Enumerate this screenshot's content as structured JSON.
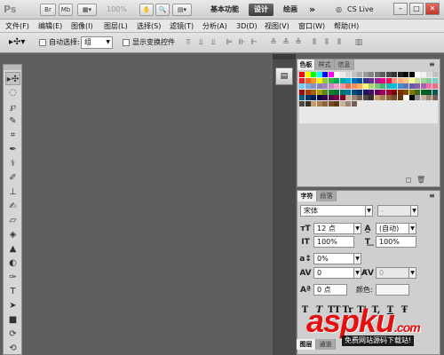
{
  "titlebar": {
    "logo": "Ps",
    "mb_label": "Mb",
    "zoom": "100%",
    "workspace_basic": "基本功能",
    "workspace_design": "设计",
    "workspace_paint": "绘画",
    "more": "»",
    "cslive": "CS Live",
    "minimize": "–",
    "restore": "□",
    "close": "✕"
  },
  "menu": [
    "文件(F)",
    "编辑(E)",
    "图像(I)",
    "图层(L)",
    "选择(S)",
    "滤镜(T)",
    "分析(A)",
    "3D(D)",
    "视图(V)",
    "窗口(W)",
    "帮助(H)"
  ],
  "options": {
    "auto_select_label": "自动选择:",
    "auto_select_value": "组",
    "show_transform_label": "显示变换控件"
  },
  "swatch_panel": {
    "tabs": [
      "色板",
      "样式",
      "信息"
    ]
  },
  "swatch_colors": [
    [
      "#ff0000",
      "#ffff00",
      "#00ff00",
      "#00ffff",
      "#0000ff",
      "#ff00ff",
      "#ffffff",
      "#ebebeb",
      "#d6d6d6",
      "#c2c2c2",
      "#adadad",
      "#999999",
      "#858585",
      "#707070",
      "#5c5c5c",
      "#474747",
      "#333333",
      "#1f1f1f",
      "#0a0a0a",
      "#000000",
      "#ffffff",
      "#f2f2f2",
      "#d9d9d9",
      "#bfbfbf"
    ],
    [
      "#ee1d24",
      "#f26522",
      "#f7941d",
      "#fff200",
      "#8dc63f",
      "#39b54a",
      "#00a651",
      "#00a99d",
      "#00aeef",
      "#0072bc",
      "#0054a6",
      "#2e3192",
      "#662d91",
      "#92278f",
      "#ec008c",
      "#ed145b",
      "#f69679",
      "#f9ad81",
      "#fdc68a",
      "#fff79a",
      "#c4df9b",
      "#a3d39c",
      "#82ca9c",
      "#7accc8"
    ],
    [
      "#6dcff6",
      "#7da7d9",
      "#8393ca",
      "#8781bd",
      "#a186be",
      "#bd8cbf",
      "#f49ac1",
      "#f5989d",
      "#f26c4f",
      "#f68e56",
      "#fbaf5d",
      "#fff568",
      "#acd373",
      "#7cc576",
      "#3cb878",
      "#1cbbb4",
      "#00bff3",
      "#448ccb",
      "#5574b9",
      "#605ca8",
      "#855fa8",
      "#a863a8",
      "#f06eaa",
      "#f26d7d"
    ],
    [
      "#9e0b0f",
      "#a0410d",
      "#a36209",
      "#aba000",
      "#598527",
      "#197b30",
      "#007236",
      "#00746b",
      "#0076a3",
      "#004a80",
      "#003471",
      "#1b1464",
      "#440e62",
      "#630460",
      "#9e005d",
      "#9e0039",
      "#790000",
      "#7b2e00",
      "#7d4900",
      "#827b00",
      "#406618",
      "#005e20",
      "#005826",
      "#005952"
    ],
    [
      "#005b7f",
      "#003663",
      "#002157",
      "#0d004c",
      "#32004b",
      "#4b0049",
      "#7b0046",
      "#7a0026",
      "#c7b299",
      "#998675",
      "#736357",
      "#534741",
      "#37302a",
      "#c69c6d",
      "#a67c52",
      "#8c6239",
      "#754c24",
      "#603913",
      "#ffffff",
      "#000000",
      "#8c8c8c",
      "#c7b299",
      "#998675",
      "#736357"
    ],
    [
      "#534741",
      "#37302a",
      "#c69c6d",
      "#a67c52",
      "#8c6239",
      "#754c24",
      "#603913",
      "#c7b299",
      "#998675",
      "#736357"
    ]
  ],
  "char_panel": {
    "tabs": [
      "字符",
      "段落"
    ],
    "font_family": "宋体",
    "font_style": "-",
    "font_size": "12 点",
    "leading": "(自动)",
    "vscale": "100%",
    "hscale": "100%",
    "baseline_pct": "0%",
    "tracking": "0",
    "kerning": "0",
    "baseline_shift": "0 点",
    "color_label": "颜色:",
    "style_buttons": [
      "T",
      "T",
      "TT",
      "Tr",
      "T'",
      "T,",
      "T",
      "Ŧ"
    ]
  },
  "bottom_tabs": [
    "图层",
    "通道"
  ],
  "watermark": {
    "main": "aspku",
    "suffix": ".com",
    "sub": "免费网站源码下载站!"
  }
}
